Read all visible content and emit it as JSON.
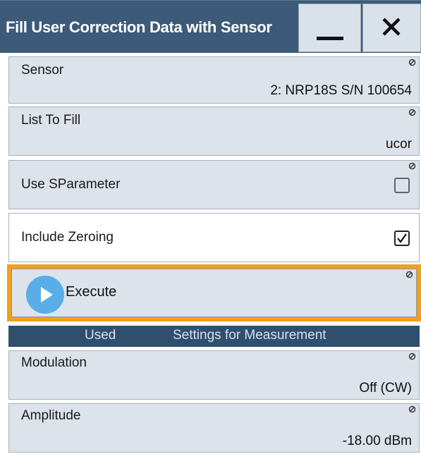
{
  "dialog": {
    "title": "Fill User Correction Data with Sensor",
    "minimize_icon": "minimize-icon",
    "close_icon": "close-icon"
  },
  "fields": {
    "sensor": {
      "label": "Sensor",
      "value": "2: NRP18S S/N 100654"
    },
    "list_to_fill": {
      "label": "List To Fill",
      "value": "ucor"
    },
    "use_sparameter": {
      "label": "Use SParameter",
      "checked": false
    },
    "include_zeroing": {
      "label": "Include Zeroing",
      "checked": true
    }
  },
  "execute": {
    "label": "Execute",
    "icon": "play-icon"
  },
  "section": {
    "used": "Used",
    "settings": "Settings for Measurement"
  },
  "measurement": {
    "modulation": {
      "label": "Modulation",
      "value": "Off (CW)"
    },
    "amplitude": {
      "label": "Amplitude",
      "value": "-18.00 dBm"
    }
  },
  "colors": {
    "titlebar": "#3d5a78",
    "field_bg": "#dde3ea",
    "focus_border": "#f0a020",
    "play_button": "#5aaee8",
    "section_header": "#2f4f6f"
  }
}
